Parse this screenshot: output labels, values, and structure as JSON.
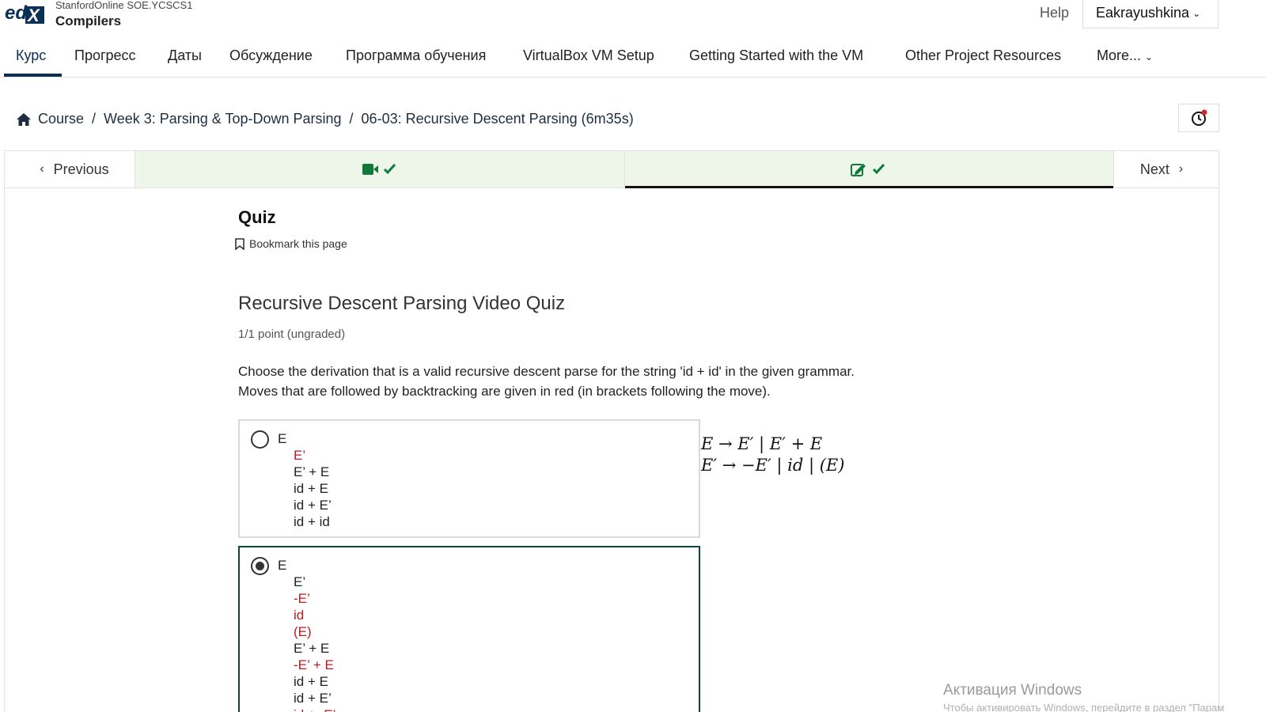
{
  "header": {
    "org": "StanfordOnline SOE.YCSCS1",
    "course_title": "Compilers",
    "help_label": "Help",
    "username": "Eakrayushkina"
  },
  "tabs": [
    {
      "label": "Курс",
      "active": true
    },
    {
      "label": "Прогресс"
    },
    {
      "label": "Даты"
    },
    {
      "label": "Обсуждение"
    },
    {
      "label": "Программа обучения"
    },
    {
      "label": "VirtualBox VM Setup"
    },
    {
      "label": "Getting Started with the VM"
    },
    {
      "label": "Other Project Resources"
    },
    {
      "label": "More..."
    }
  ],
  "breadcrumb": {
    "items": [
      "Course",
      "Week 3: Parsing & Top-Down Parsing",
      "06-03: Recursive Descent Parsing (6m35s)"
    ],
    "sep": "/"
  },
  "sequence": {
    "previous_label": "Previous",
    "next_label": "Next",
    "units": [
      {
        "icon": "video-icon",
        "completed": true
      },
      {
        "icon": "edit-icon",
        "completed": true,
        "active": true
      }
    ]
  },
  "unit": {
    "title": "Quiz",
    "bookmark_label": "Bookmark this page"
  },
  "problem": {
    "title": "Recursive Descent Parsing Video Quiz",
    "points": "1/1 point (ungraded)",
    "prompt_line1": "Choose the derivation that is a valid recursive descent parse for the string 'id + id' in the given grammar.",
    "prompt_line2": "Moves that are followed by backtracking are given in red (in brackets following the move).",
    "grammar_line1": "E → E′ | E′ + E",
    "grammar_line2": "E′ → −E′ | id | (E)",
    "choices": [
      {
        "selected": false,
        "steps": [
          {
            "text": "E",
            "red": false
          },
          {
            "text": "E’",
            "red": true
          },
          {
            "text": "E’ + E",
            "red": false
          },
          {
            "text": "id + E",
            "red": false
          },
          {
            "text": "id + E’",
            "red": false
          },
          {
            "text": "id + id",
            "red": false
          }
        ]
      },
      {
        "selected": true,
        "steps": [
          {
            "text": "E",
            "red": false
          },
          {
            "text": "E’",
            "red": false
          },
          {
            "text": "-E’",
            "red": true
          },
          {
            "text": "id",
            "red": true
          },
          {
            "text": "(E)",
            "red": true
          },
          {
            "text": "E’ + E",
            "red": false
          },
          {
            "text": "-E’ + E",
            "red": true
          },
          {
            "text": "id + E",
            "red": false
          },
          {
            "text": "id + E’",
            "red": false
          },
          {
            "text": "id + -E’",
            "red": true
          }
        ]
      }
    ]
  },
  "watermark": {
    "title": "Активация Windows",
    "subtitle": "Чтобы активировать Windows, перейдите в раздел \"Парам"
  },
  "colors": {
    "accent": "#0a3055",
    "completed_bg": "#eef6e9",
    "check": "#0d7a3c",
    "backtrack_red": "#c0191e",
    "selected_border": "#0d4a3c"
  }
}
